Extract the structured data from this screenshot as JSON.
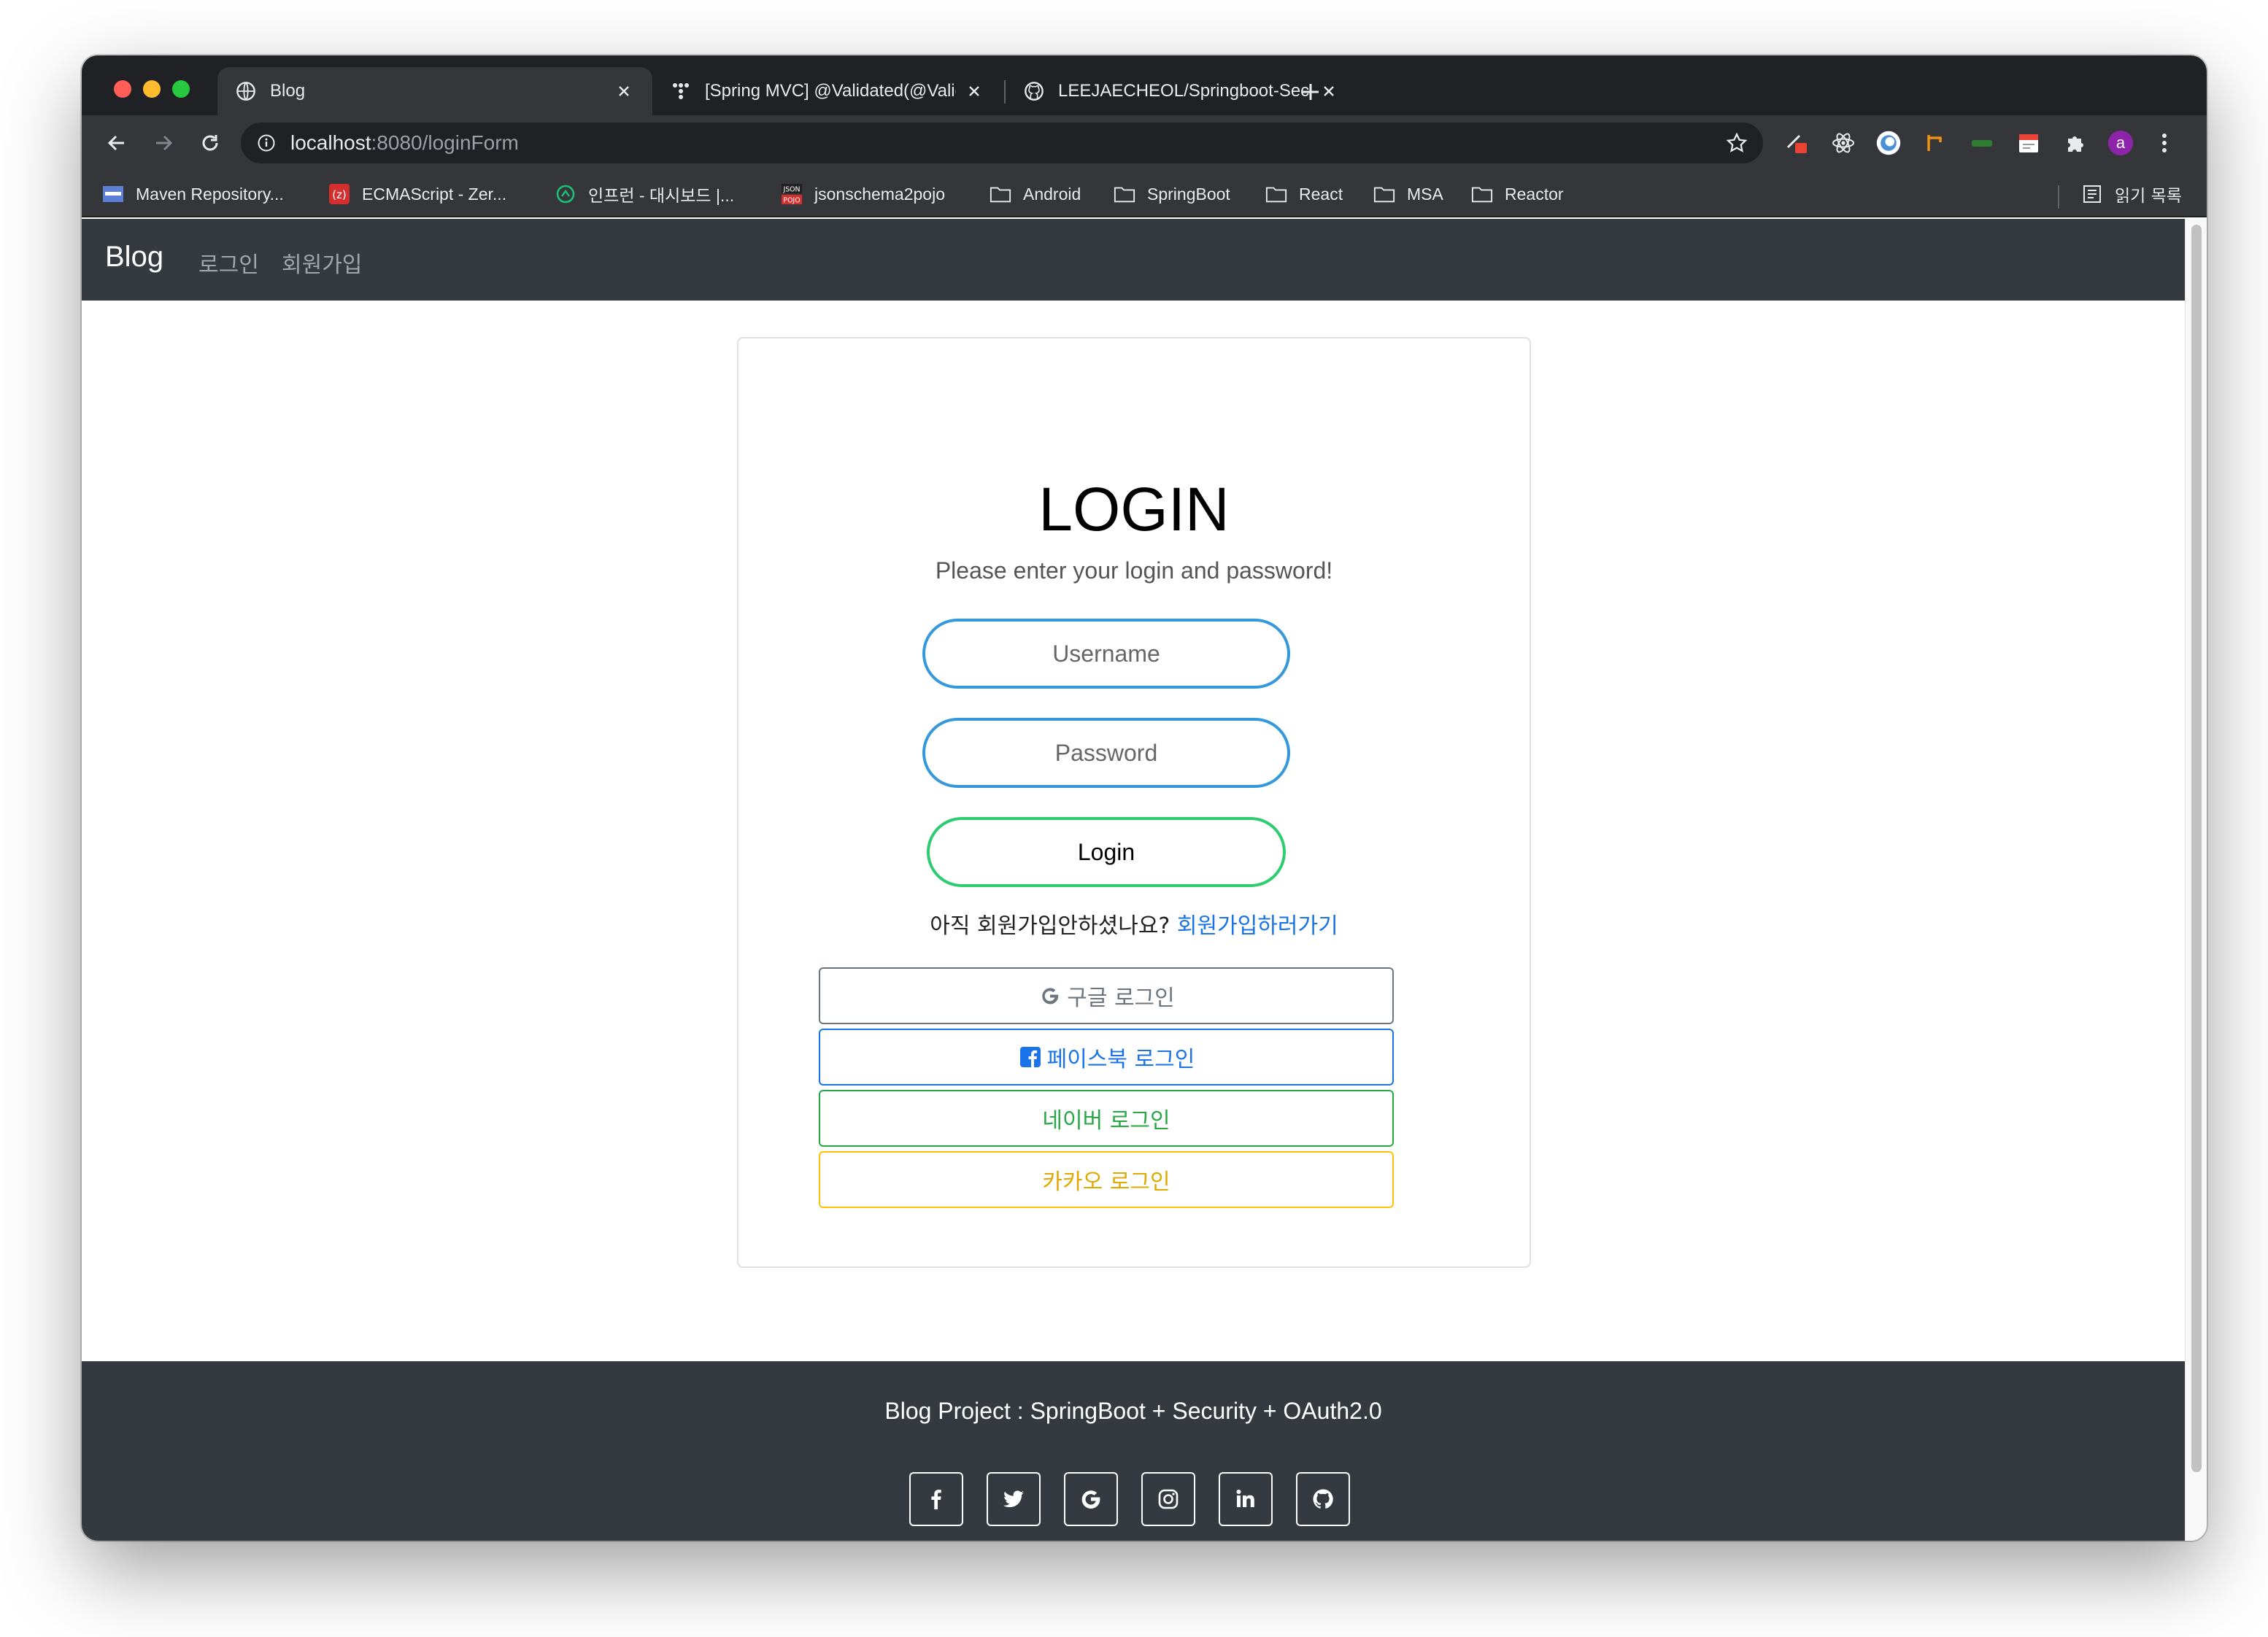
{
  "browser": {
    "tabs": [
      {
        "title": "Blog",
        "icon": "globe-icon"
      },
      {
        "title": "[Spring MVC] @Validated(@Valid)",
        "icon": "tistory-icon"
      },
      {
        "title": "LEEJAECHEOL/Springboot-Security",
        "icon": "github-icon"
      }
    ],
    "url": {
      "host": "localhost",
      "rest": ":8080/loginForm"
    },
    "bookmarks": [
      {
        "label": "Maven Repository...",
        "icon": "maven-icon"
      },
      {
        "label": "ECMAScript - Zer...",
        "icon": "zero-icon"
      },
      {
        "label": "인프런 - 대시보드 |...",
        "icon": "inflearn-icon"
      },
      {
        "label": "jsonschema2pojo",
        "icon": "json-pojo-icon"
      },
      {
        "label": "Android",
        "icon": "folder-icon"
      },
      {
        "label": "SpringBoot",
        "icon": "folder-icon"
      },
      {
        "label": "React",
        "icon": "folder-icon"
      },
      {
        "label": "MSA",
        "icon": "folder-icon"
      },
      {
        "label": "Reactor",
        "icon": "folder-icon"
      }
    ],
    "reading_list": "읽기 목록",
    "profile_initial": "a"
  },
  "site": {
    "brand": "Blog",
    "nav": [
      "로그인",
      "회원가입"
    ]
  },
  "login": {
    "title": "LOGIN",
    "subtitle": "Please enter your login and password!",
    "username_placeholder": "Username",
    "password_placeholder": "Password",
    "submit_label": "Login",
    "signup_prompt": "아직 회원가입안하셨나요?",
    "signup_link": "회원가입하러가기",
    "social": {
      "google": "구글 로그인",
      "facebook": "페이스북 로그인",
      "naver": "네이버 로그인",
      "kakao": "카카오 로그인"
    }
  },
  "footer": {
    "text": "Blog Project : SpringBoot + Security + OAuth2.0",
    "icons": [
      "facebook-icon",
      "twitter-icon",
      "google-icon",
      "instagram-icon",
      "linkedin-icon",
      "github-icon"
    ]
  },
  "colors": {
    "navbar": "#343a40",
    "input_border": "#3498db",
    "login_border": "#2ecc71",
    "link": "#1a73e8",
    "kakao": "#ffc107",
    "naver": "#28a745"
  }
}
